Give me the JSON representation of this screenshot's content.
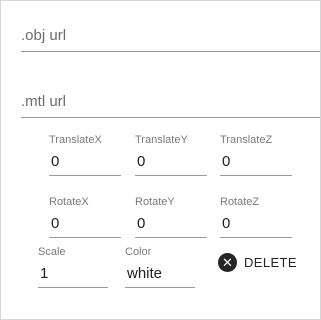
{
  "obj": {
    "placeholder": ".obj url"
  },
  "mtl": {
    "placeholder": ".mtl url"
  },
  "translate": {
    "x": {
      "label": "TranslateX",
      "value": "0"
    },
    "y": {
      "label": "TranslateY",
      "value": "0"
    },
    "z": {
      "label": "TranslateZ",
      "value": "0"
    }
  },
  "rotate": {
    "x": {
      "label": "RotateX",
      "value": "0"
    },
    "y": {
      "label": "RotateY",
      "value": "0"
    },
    "z": {
      "label": "RotateZ",
      "value": "0"
    }
  },
  "scale": {
    "label": "Scale",
    "value": "1"
  },
  "color": {
    "label": "Color",
    "value": "white"
  },
  "delete": {
    "label": "DELETE",
    "icon": "close-circle-icon"
  }
}
